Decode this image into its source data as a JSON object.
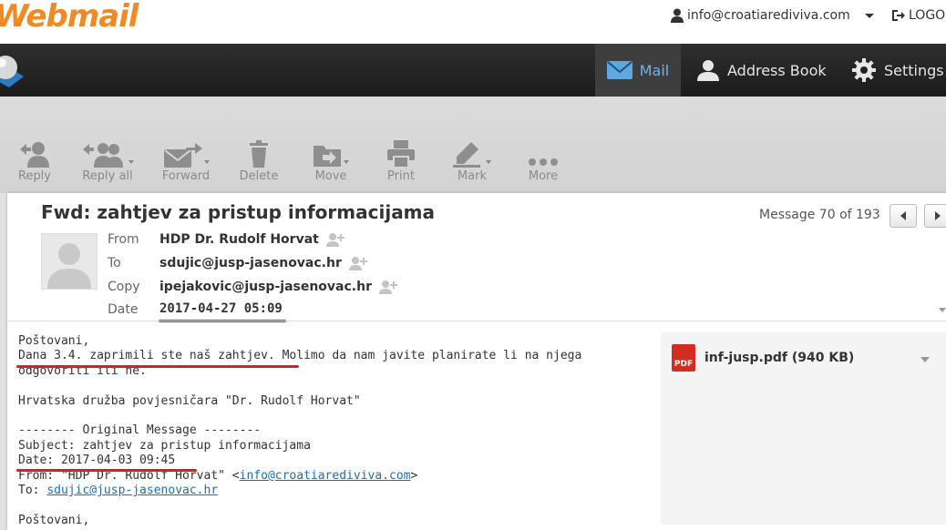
{
  "app": {
    "logo": "Webmail"
  },
  "header": {
    "user_email": "info@croatiarediviva.com",
    "logout_label": "LOGOUT"
  },
  "nav": {
    "mail": "Mail",
    "address_book": "Address Book",
    "settings": "Settings"
  },
  "toolbar": {
    "reply": "Reply",
    "reply_all": "Reply all",
    "forward": "Forward",
    "delete": "Delete",
    "move": "Move",
    "print": "Print",
    "mark": "Mark",
    "more": "More"
  },
  "message": {
    "subject": "Fwd: zahtjev za pristup informacijama",
    "counter": "Message 70 of 193",
    "labels": {
      "from": "From",
      "to": "To",
      "copy": "Copy",
      "date": "Date"
    },
    "from": "HDP Dr. Rudolf Horvat",
    "to": "sdujic@jusp-jasenovac.hr",
    "copy": "ipejakovic@jusp-jasenovac.hr",
    "date": "2017-04-27 05:09"
  },
  "body": {
    "line1": "Poštovani,",
    "line2": "Dana 3.4. zaprimili ste naš zahtjev. Molimo da nam javite planirate li na njega",
    "line3": "odgovoriti ili ne.",
    "line5": "Hrvatska družba povjesničara \"Dr. Rudolf Horvat\"",
    "line7": "-------- Original Message --------",
    "line8": "Subject: zahtjev za pristup informacijama",
    "line9": "Date: 2017-04-03 09:45",
    "line10_prefix": "From: \"HDP Dr. Rudolf Horvat\" <",
    "line10_link": "info@croatiarediviva.com",
    "line10_suffix": ">",
    "line11_prefix": "To: ",
    "line11_link": "sdujic@jusp-jasenovac.hr",
    "line13": "Poštovani,"
  },
  "attachment": {
    "name": "inf-jusp.pdf (940 KB)",
    "type_label": "PDF"
  },
  "colors": {
    "accent": "#f08a24",
    "nav_active": "#6fb4e6",
    "annotation": "#d61f26",
    "link": "#1a6fb5"
  }
}
